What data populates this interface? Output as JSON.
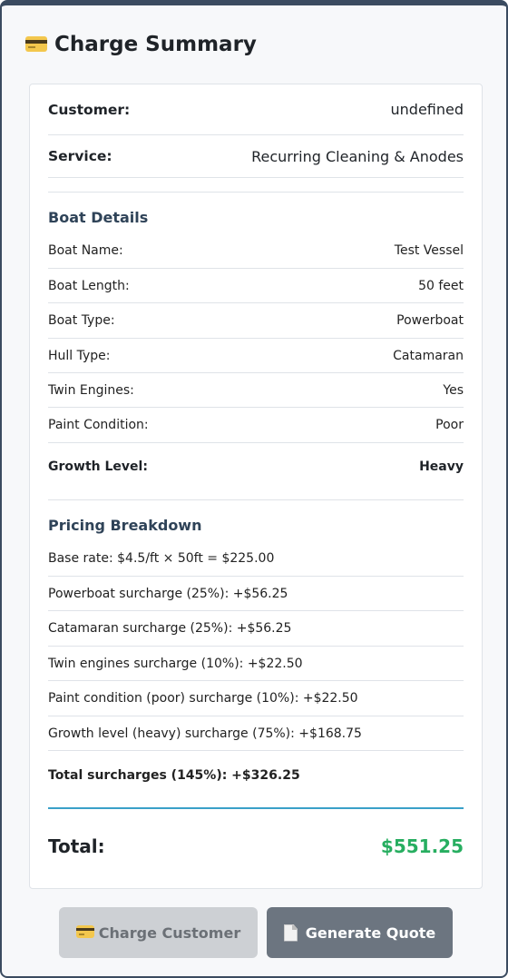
{
  "header": {
    "title": "Charge Summary",
    "icon": "credit-card-icon"
  },
  "summary": {
    "customer_label": "Customer:",
    "customer_value": "undefined",
    "service_label": "Service:",
    "service_value": "Recurring Cleaning & Anodes"
  },
  "boat": {
    "title": "Boat Details",
    "rows": [
      {
        "label": "Boat Name:",
        "value": "Test Vessel"
      },
      {
        "label": "Boat Length:",
        "value": "50 feet"
      },
      {
        "label": "Boat Type:",
        "value": "Powerboat"
      },
      {
        "label": "Hull Type:",
        "value": "Catamaran"
      },
      {
        "label": "Twin Engines:",
        "value": "Yes"
      },
      {
        "label": "Paint Condition:",
        "value": "Poor"
      }
    ],
    "growth_label": "Growth Level:",
    "growth_value": "Heavy"
  },
  "pricing": {
    "title": "Pricing Breakdown",
    "lines": [
      "Base rate: $4.5/ft × 50ft = $225.00",
      "Powerboat surcharge (25%): +$56.25",
      "Catamaran surcharge (25%): +$56.25",
      "Twin engines surcharge (10%): +$22.50",
      "Paint condition (poor) surcharge (10%): +$22.50",
      "Growth level (heavy) surcharge (75%): +$168.75"
    ],
    "total_surcharges": "Total surcharges (145%): +$326.25"
  },
  "total": {
    "label": "Total:",
    "value": "$551.25",
    "color": "#27ae60"
  },
  "buttons": {
    "charge_label": "Charge Customer",
    "charge_icon": "credit-card-icon",
    "quote_label": "Generate Quote",
    "quote_icon": "document-icon"
  }
}
